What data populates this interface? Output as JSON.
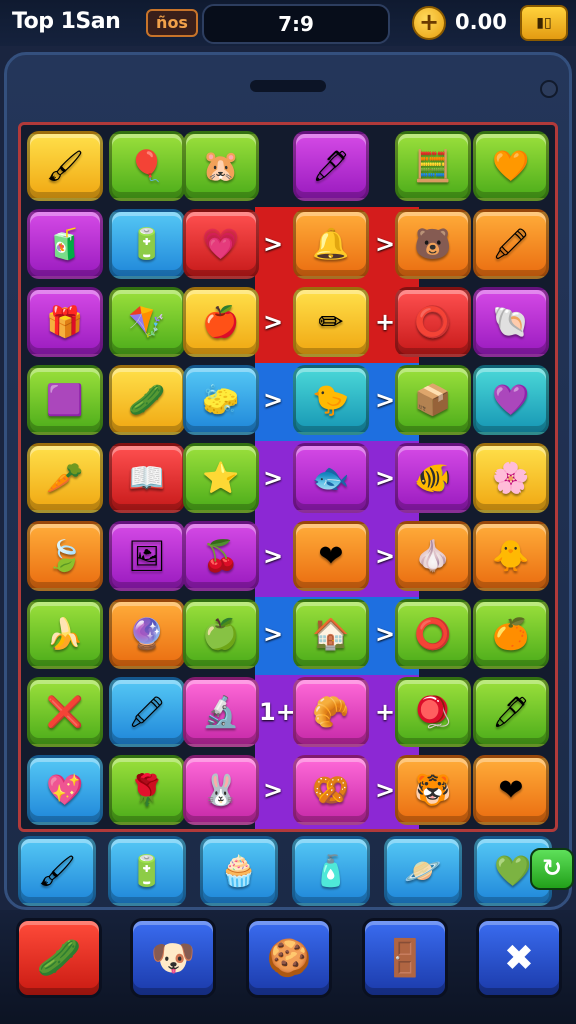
{
  "header": {
    "title": "Top 1San",
    "level_badge": "ños",
    "score": "7:9",
    "coin_add_symbol": "+",
    "coins": "0.00",
    "wallet_glyph": "▮▯"
  },
  "colors": {
    "background": "#1a2540",
    "board_border": "#b13a3a",
    "lane_red": "#d41c1c",
    "lane_blue": "#1e6fe0",
    "lane_purple": "#8c28d4"
  },
  "lanes": [
    {
      "row": 1,
      "color": "red",
      "arrows": [
        ">",
        ">"
      ]
    },
    {
      "row": 2,
      "color": "red",
      "arrows": [
        ">",
        "+"
      ]
    },
    {
      "row": 3,
      "color": "blue",
      "arrows": [
        ">",
        ">"
      ]
    },
    {
      "row": 4,
      "color": "purple",
      "arrows": [
        ">",
        ">"
      ]
    },
    {
      "row": 5,
      "color": "purple",
      "arrows": [
        ">",
        ">"
      ]
    },
    {
      "row": 6,
      "color": "blue",
      "arrows": [
        ">",
        ">"
      ]
    },
    {
      "row": 7,
      "color": "purple",
      "arrows": [
        "1+",
        "+"
      ]
    },
    {
      "row": 8,
      "color": "purple",
      "arrows": [
        ">",
        ">"
      ]
    }
  ],
  "grid": [
    [
      {
        "color": "yellow",
        "icon": "🖌",
        "name": "brush-icon"
      },
      {
        "color": "green",
        "icon": "🎈",
        "name": "ball-icon"
      },
      {
        "color": "green",
        "icon": "🐹",
        "name": "hamster-icon"
      },
      {
        "color": "purple",
        "icon": "🖊",
        "name": "pen-icon"
      },
      {
        "color": "green",
        "icon": "🧮",
        "name": "tool-icon"
      },
      {
        "color": "green",
        "icon": "🧡",
        "name": "heart-icon"
      }
    ],
    [
      {
        "color": "purple",
        "icon": "🧃",
        "name": "can-icon"
      },
      {
        "color": "blue",
        "icon": "🔋",
        "name": "battery-icon"
      },
      {
        "color": "red",
        "icon": "💗",
        "name": "heart-icon"
      },
      {
        "color": "orange",
        "icon": "🔔",
        "name": "bell-icon"
      },
      {
        "color": "orange",
        "icon": "🐻",
        "name": "bear-icon"
      },
      {
        "color": "orange",
        "icon": "🖍",
        "name": "crayon-icon"
      }
    ],
    [
      {
        "color": "purple",
        "icon": "🎁",
        "name": "box-icon"
      },
      {
        "color": "green",
        "icon": "🪁",
        "name": "easel-icon"
      },
      {
        "color": "yellow",
        "icon": "🍎",
        "name": "apple-icon"
      },
      {
        "color": "yellow",
        "icon": "✏",
        "name": "pencil-icon"
      },
      {
        "color": "red",
        "icon": "⭕",
        "name": "ring-icon"
      },
      {
        "color": "purple",
        "icon": "🐚",
        "name": "shell-icon"
      }
    ],
    [
      {
        "color": "green",
        "icon": "🟪",
        "name": "cube-icon"
      },
      {
        "color": "yellow",
        "icon": "🥒",
        "name": "cucumber-icon"
      },
      {
        "color": "blue",
        "icon": "🧽",
        "name": "eraser-icon"
      },
      {
        "color": "teal",
        "icon": "🐤",
        "name": "duck-icon"
      },
      {
        "color": "green",
        "icon": "📦",
        "name": "crate-icon"
      },
      {
        "color": "teal",
        "icon": "💜",
        "name": "heart-icon"
      }
    ],
    [
      {
        "color": "yellow",
        "icon": "🥕",
        "name": "carrot-icon"
      },
      {
        "color": "red",
        "icon": "📖",
        "name": "book-icon"
      },
      {
        "color": "green",
        "icon": "⭐",
        "name": "star-icon"
      },
      {
        "color": "purple",
        "icon": "🐟",
        "name": "fish-icon"
      },
      {
        "color": "purple",
        "icon": "🐠",
        "name": "fish-icon"
      },
      {
        "color": "yellow",
        "icon": "🌸",
        "name": "flower-icon"
      }
    ],
    [
      {
        "color": "orange",
        "icon": "🍃",
        "name": "leaf-icon"
      },
      {
        "color": "purple",
        "icon": "🖼",
        "name": "picture-icon"
      },
      {
        "color": "purple",
        "icon": "🍒",
        "name": "cherry-icon"
      },
      {
        "color": "orange",
        "icon": "❤",
        "name": "heart-icon"
      },
      {
        "color": "orange",
        "icon": "🧄",
        "name": "garlic-icon"
      },
      {
        "color": "orange",
        "icon": "🐥",
        "name": "chick-icon"
      }
    ],
    [
      {
        "color": "green",
        "icon": "🍌",
        "name": "banana-icon"
      },
      {
        "color": "orange",
        "icon": "🔮",
        "name": "orb-icon"
      },
      {
        "color": "green",
        "icon": "🍏",
        "name": "apple-icon"
      },
      {
        "color": "green",
        "icon": "🏠",
        "name": "house-icon"
      },
      {
        "color": "green",
        "icon": "⭕",
        "name": "ring-icon"
      },
      {
        "color": "green",
        "icon": "🍊",
        "name": "orange-icon"
      }
    ],
    [
      {
        "color": "green",
        "icon": "❌",
        "name": "x-icon"
      },
      {
        "color": "blue",
        "icon": "🖍",
        "name": "crayon-icon"
      },
      {
        "color": "pink",
        "icon": "🔬",
        "name": "globe-icon"
      },
      {
        "color": "pink",
        "icon": "🥐",
        "name": "croissant-icon"
      },
      {
        "color": "green",
        "icon": "🪀",
        "name": "ball-icon"
      },
      {
        "color": "green",
        "icon": "🖊",
        "name": "marker-icon"
      }
    ],
    [
      {
        "color": "blue",
        "icon": "💖",
        "name": "heart-icon"
      },
      {
        "color": "green",
        "icon": "🌹",
        "name": "rose-icon"
      },
      {
        "color": "pink",
        "icon": "🐰",
        "name": "bunny-icon"
      },
      {
        "color": "pink",
        "icon": "🥨",
        "name": "pretzel-icon"
      },
      {
        "color": "orange",
        "icon": "🐯",
        "name": "tiger-icon"
      },
      {
        "color": "orange",
        "icon": "❤",
        "name": "heart-icon"
      }
    ]
  ],
  "tray": [
    {
      "color": "blue",
      "icon": "🖌",
      "name": "brush-icon"
    },
    {
      "color": "blue",
      "icon": "🔋",
      "name": "battery-icon"
    },
    {
      "color": "blue",
      "icon": "🧁",
      "name": "cupcake-icon"
    },
    {
      "color": "blue",
      "icon": "🧴",
      "name": "bottle-icon"
    },
    {
      "color": "blue",
      "icon": "🪐",
      "name": "planet-icon"
    },
    {
      "color": "blue",
      "icon": "💚",
      "name": "heart-icon"
    }
  ],
  "shuffle_symbol": "↻",
  "powerups": [
    {
      "color": "red",
      "icon": "🥒",
      "name": "cucumber-powerup-icon"
    },
    {
      "color": "blue",
      "icon": "🐶",
      "name": "dog-powerup-icon"
    },
    {
      "color": "blue",
      "icon": "🍪",
      "name": "cookie-powerup-icon"
    },
    {
      "color": "blue",
      "icon": "🚪",
      "name": "door-powerup-icon"
    },
    {
      "color": "blue",
      "icon": "✖",
      "name": "x-powerup-icon"
    }
  ]
}
